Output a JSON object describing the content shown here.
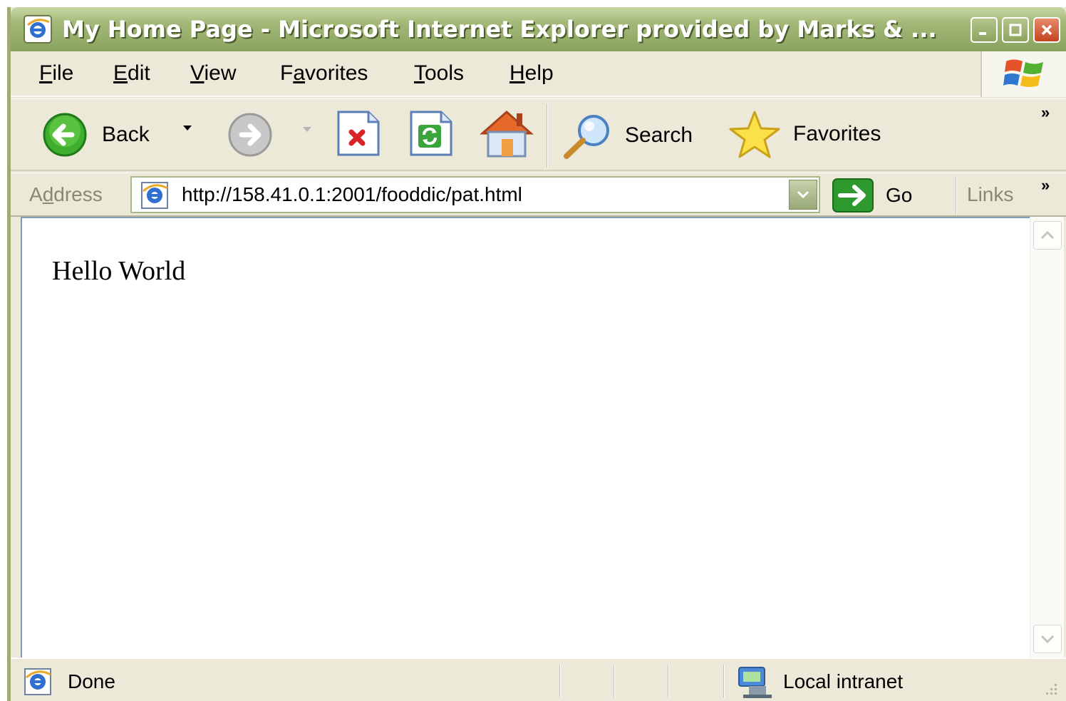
{
  "window": {
    "title": "My Home Page - Microsoft Internet Explorer provided by Marks & ...",
    "buttons": {
      "minimize": "minimize",
      "maximize": "maximize",
      "close": "close"
    }
  },
  "menu": {
    "items": [
      {
        "prefix": "",
        "underline": "F",
        "rest": "ile"
      },
      {
        "prefix": "",
        "underline": "E",
        "rest": "dit"
      },
      {
        "prefix": "",
        "underline": "V",
        "rest": "iew"
      },
      {
        "prefix": "F",
        "underline": "a",
        "rest": "vorites"
      },
      {
        "prefix": "",
        "underline": "T",
        "rest": "ools"
      },
      {
        "prefix": "",
        "underline": "H",
        "rest": "elp"
      }
    ]
  },
  "toolbar": {
    "back_label": "Back",
    "search_label": "Search",
    "favorites_label": "Favorites",
    "more": "»"
  },
  "address": {
    "label_prefix": "A",
    "label_underline": "d",
    "label_rest": "dress",
    "url": "http://158.41.0.1:2001/fooddic/pat.html",
    "go_label": "Go",
    "links_label": "Links",
    "links_more": "»"
  },
  "page": {
    "body_text": "Hello World"
  },
  "status": {
    "text": "Done",
    "zone": "Local intranet"
  },
  "colors": {
    "titlebar": "#8aa35f",
    "chrome": "#ece9d8",
    "go_green": "#2e9a2e"
  }
}
